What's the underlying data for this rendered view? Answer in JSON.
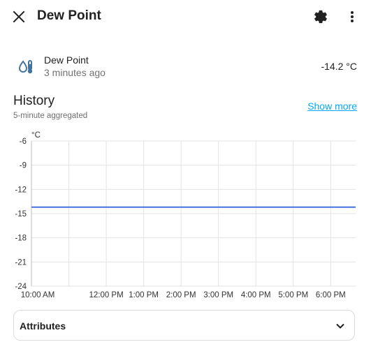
{
  "dialog": {
    "title": "Dew Point"
  },
  "entity": {
    "name": "Dew Point",
    "last_changed": "3 minutes ago",
    "state": "-14.2 °C",
    "icon": "thermometer-water-icon"
  },
  "history": {
    "title": "History",
    "subtitle": "5-minute aggregated",
    "show_more": "Show more"
  },
  "attributes": {
    "label": "Attributes"
  },
  "colors": {
    "accent": "#03a9f4",
    "series": "#4472e6",
    "icon": "#44739e"
  },
  "chart_data": {
    "type": "line",
    "unit": "°C",
    "ylim": [
      -24,
      -6
    ],
    "y_ticks": [
      -6,
      -9,
      -12,
      -15,
      -18,
      -21,
      -24
    ],
    "x_ticks": [
      "10:00 AM",
      "12:00 PM",
      "1:00 PM",
      "2:00 PM",
      "3:00 PM",
      "4:00 PM",
      "5:00 PM",
      "6:00 PM"
    ],
    "x_range": [
      "10:00",
      "18:40"
    ],
    "series": [
      {
        "points": [
          {
            "x": "10:00",
            "y": -14.2
          },
          {
            "x": "18:40",
            "y": -14.2
          }
        ]
      }
    ],
    "grid": true
  }
}
